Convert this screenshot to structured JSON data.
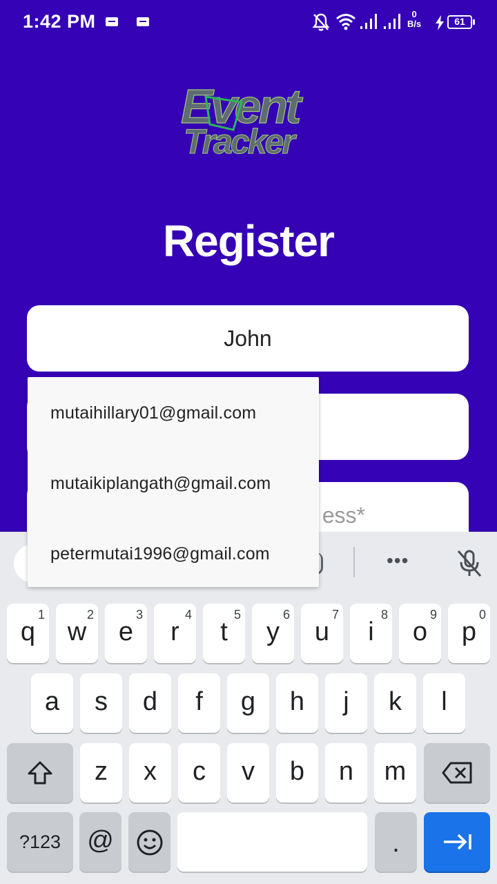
{
  "status_bar": {
    "time": "1:42 PM",
    "net_rate_value": "0",
    "net_rate_unit": "B/s",
    "battery": "61",
    "icons": [
      "message-icon",
      "message-icon",
      "bell-off-icon",
      "wifi-icon",
      "signal-icon",
      "signal-icon",
      "charging-icon",
      "battery-icon"
    ]
  },
  "logo": {
    "line1": "Event",
    "line2": "Tracker"
  },
  "title": "Register",
  "form": {
    "name_value": "John",
    "email_placeholder": "ess*"
  },
  "autofill": {
    "suggestions": [
      "mutaihillary01@gmail.com",
      "mutaikiplangath@gmail.com",
      "petermutai1996@gmail.com"
    ]
  },
  "keyboard": {
    "row1": [
      {
        "ch": "q",
        "num": "1"
      },
      {
        "ch": "w",
        "num": "2"
      },
      {
        "ch": "e",
        "num": "3"
      },
      {
        "ch": "r",
        "num": "4"
      },
      {
        "ch": "t",
        "num": "5"
      },
      {
        "ch": "y",
        "num": "6"
      },
      {
        "ch": "u",
        "num": "7"
      },
      {
        "ch": "i",
        "num": "8"
      },
      {
        "ch": "o",
        "num": "9"
      },
      {
        "ch": "p",
        "num": "0"
      }
    ],
    "row2": [
      "a",
      "s",
      "d",
      "f",
      "g",
      "h",
      "j",
      "k",
      "l"
    ],
    "row3": [
      "z",
      "x",
      "c",
      "v",
      "b",
      "n",
      "m"
    ],
    "more_label": "•••",
    "symbols_label": "?123",
    "at_label": "@",
    "dot_label": ".",
    "accent_color": "#1a73e8"
  },
  "colors": {
    "background": "#3503b5"
  }
}
